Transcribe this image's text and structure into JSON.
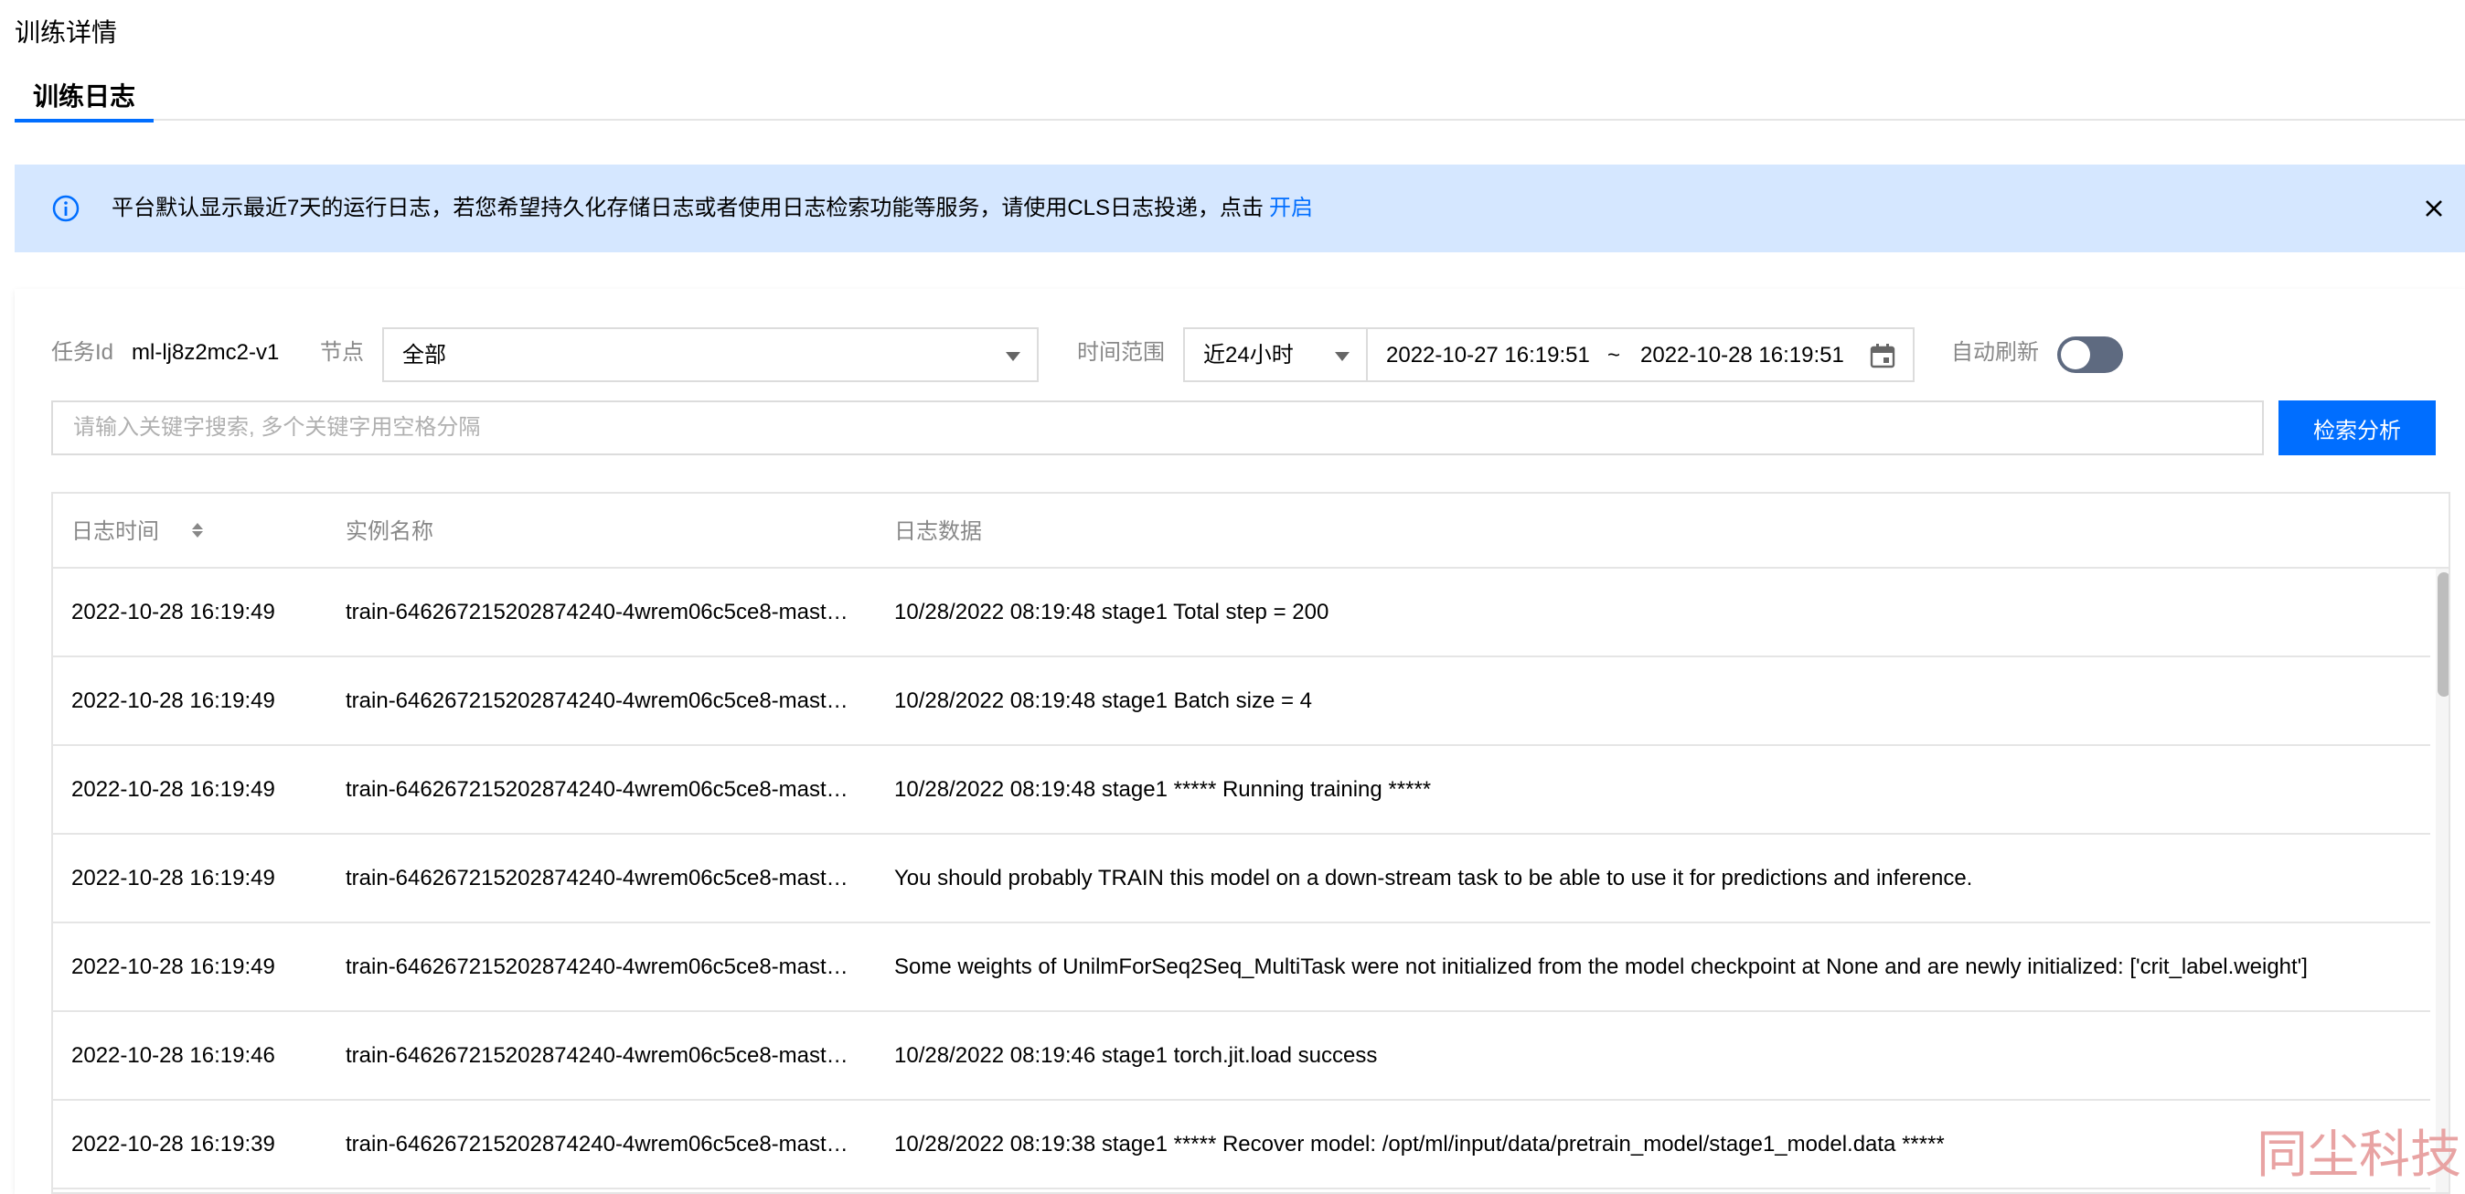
{
  "page": {
    "title": "训练详情"
  },
  "tabs": [
    {
      "label": "训练日志",
      "active": true
    }
  ],
  "notice": {
    "text": "平台默认显示最近7天的运行日志，若您希望持久化存储日志或者使用日志检索功能等服务，请使用CLS日志投递，点击",
    "link": "开启"
  },
  "filters": {
    "task_id_label": "任务Id",
    "task_id": "ml-lj8z2mc2-v1",
    "node_label": "节点",
    "node_value": "全部",
    "time_label": "时间范围",
    "time_range": "近24小时",
    "start": "2022-10-27 16:19:51",
    "separator": "~",
    "end": "2022-10-28 16:19:51",
    "auto_refresh_label": "自动刷新",
    "auto_refresh": false
  },
  "search": {
    "placeholder": "请输入关键字搜索, 多个关键字用空格分隔",
    "button": "检索分析"
  },
  "table": {
    "columns": [
      "日志时间",
      "实例名称",
      "日志数据"
    ],
    "rows": [
      {
        "time": "2022-10-28 16:19:49",
        "instance": "train-646267215202874240-4wrem06c5ce8-mast…",
        "data": "10/28/2022 08:19:48 stage1 Total step = 200"
      },
      {
        "time": "2022-10-28 16:19:49",
        "instance": "train-646267215202874240-4wrem06c5ce8-mast…",
        "data": "10/28/2022 08:19:48 stage1 Batch size = 4"
      },
      {
        "time": "2022-10-28 16:19:49",
        "instance": "train-646267215202874240-4wrem06c5ce8-mast…",
        "data": "10/28/2022 08:19:48 stage1 ***** Running training *****"
      },
      {
        "time": "2022-10-28 16:19:49",
        "instance": "train-646267215202874240-4wrem06c5ce8-mast…",
        "data": "You should probably TRAIN this model on a down-stream task to be able to use it for predictions and inference."
      },
      {
        "time": "2022-10-28 16:19:49",
        "instance": "train-646267215202874240-4wrem06c5ce8-mast…",
        "data": "Some weights of UnilmForSeq2Seq_MultiTask were not initialized from the model checkpoint at None and are newly initialized: ['crit_label.weight']"
      },
      {
        "time": "2022-10-28 16:19:46",
        "instance": "train-646267215202874240-4wrem06c5ce8-mast…",
        "data": "10/28/2022 08:19:46 stage1 torch.jit.load success"
      },
      {
        "time": "2022-10-28 16:19:39",
        "instance": "train-646267215202874240-4wrem06c5ce8-mast…",
        "data": "10/28/2022 08:19:38 stage1 ***** Recover model: /opt/ml/input/data/pretrain_model/stage1_model.data *****"
      }
    ]
  },
  "watermark": "同尘科技",
  "colors": {
    "accent": "#006eff",
    "notice_bg": "#d5e7ff",
    "toggle_off": "#5e6a80",
    "watermark": "#e8a3a3"
  },
  "icons": {
    "notice": "info-icon",
    "close": "close-icon",
    "calendar": "calendar-icon",
    "sort": "sort-icon",
    "dropdown": "chevron-down-icon"
  }
}
